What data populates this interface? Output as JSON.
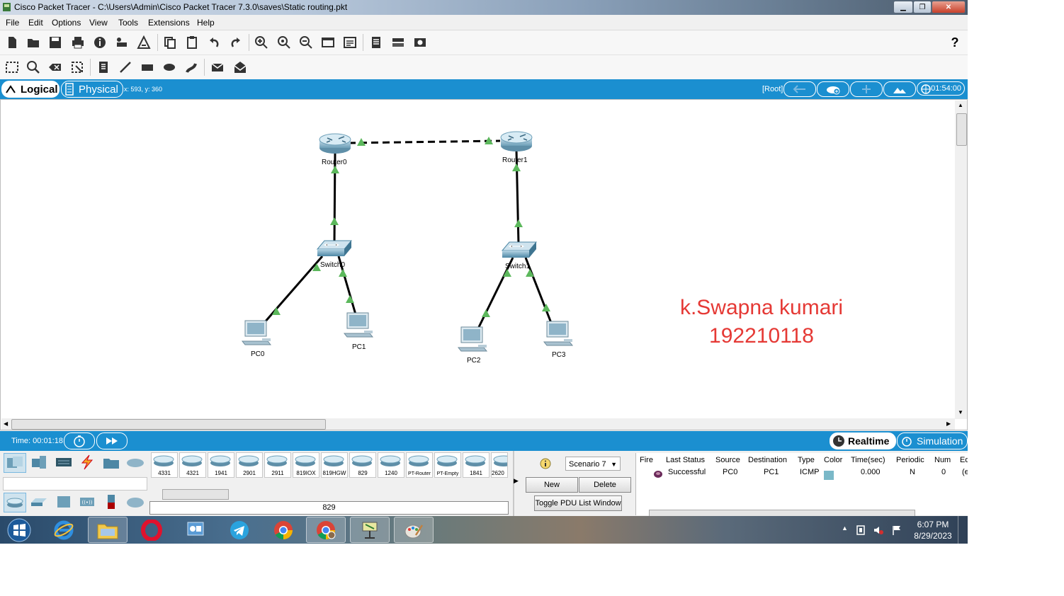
{
  "window": {
    "title": "Cisco Packet Tracer - C:\\Users\\Admin\\Cisco Packet Tracer 7.3.0\\saves\\Static routing.pkt"
  },
  "menu": [
    "File",
    "Edit",
    "Options",
    "View",
    "Tools",
    "Extensions",
    "Help"
  ],
  "topbar": {
    "logical": "Logical",
    "physical": "Physical",
    "coords": "x: 593, y: 360",
    "root": "[Root]",
    "clock": "01:54:00"
  },
  "devices": {
    "router0": "Router0",
    "router1": "Router1",
    "switch0": "Switch0",
    "switch1": "Switch1",
    "pc0": "PC0",
    "pc1": "PC1",
    "pc2": "PC2",
    "pc3": "PC3"
  },
  "watermark": {
    "line1": "k.Swapna kumari",
    "line2": "192210118"
  },
  "bottombar": {
    "time": "Time: 00:01:18",
    "realtime": "Realtime",
    "simulation": "Simulation"
  },
  "models": [
    "4331",
    "4321",
    "1941",
    "2901",
    "2911",
    "819IOX",
    "819HGW",
    "829",
    "1240",
    "PT-Router",
    "PT-Empty",
    "1841",
    "2620"
  ],
  "selected_model": "829",
  "scenario": {
    "selected": "Scenario 7",
    "new": "New",
    "delete": "Delete",
    "toggle": "Toggle PDU List Window"
  },
  "pdu_table": {
    "headers": [
      "Fire",
      "Last Status",
      "Source",
      "Destination",
      "Type",
      "Color",
      "Time(sec)",
      "Periodic",
      "Num",
      "Ed"
    ],
    "row": {
      "last_status": "Successful",
      "source": "PC0",
      "destination": "PC1",
      "type": "ICMP",
      "color": "#7ab8c8",
      "time": "0.000",
      "periodic": "N",
      "num": "0",
      "edit": "(e"
    }
  },
  "taskbar": {
    "time": "6:07 PM",
    "date": "8/29/2023"
  },
  "colors": {
    "accent": "#1b8fd0",
    "link_up": "#5cb85c",
    "watermark": "#e53935"
  }
}
